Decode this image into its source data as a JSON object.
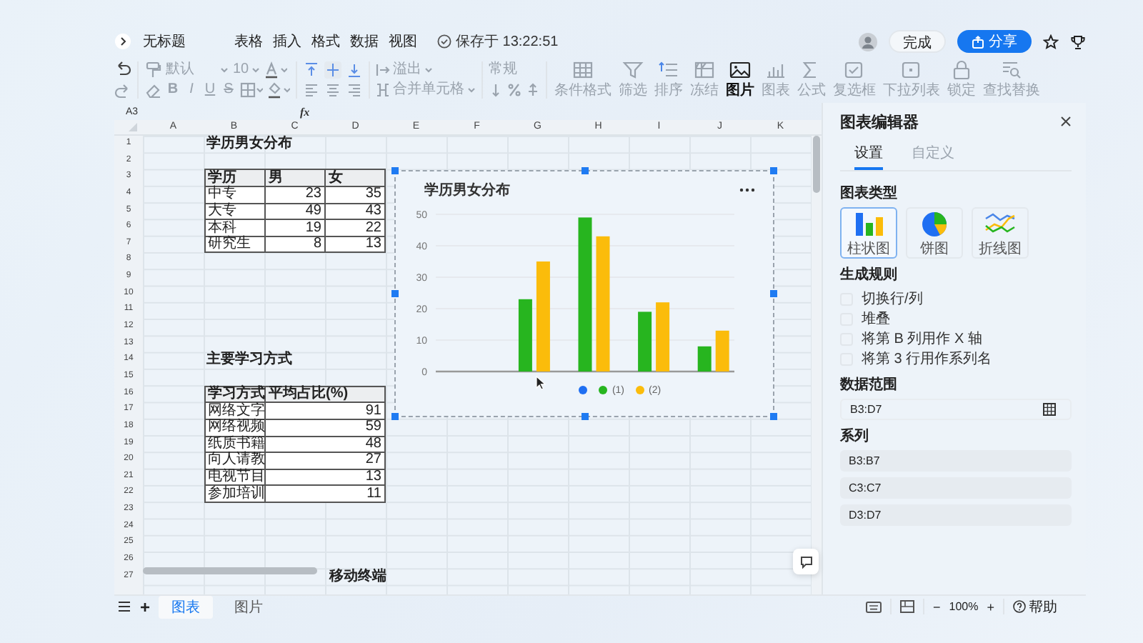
{
  "topbar": {
    "title": "无标题",
    "menus": [
      "表格",
      "插入",
      "格式",
      "数据",
      "视图"
    ],
    "save_status": "保存于 13:22:51",
    "done_button": "完成",
    "share_button": "分享"
  },
  "toolbar": {
    "font": "默认",
    "font_size": "10",
    "format_buttons": [
      "B",
      "I",
      "U",
      "S"
    ],
    "wrap": "溢出",
    "merge": "合并单元格",
    "number_format": "常规",
    "tools": [
      {
        "kind": "conditional",
        "label": "条件格式",
        "active": false
      },
      {
        "kind": "filter",
        "label": "筛选",
        "active": false
      },
      {
        "kind": "sort",
        "label": "排序",
        "active": false
      },
      {
        "kind": "freeze",
        "label": "冻结",
        "active": false
      },
      {
        "kind": "image",
        "label": "图片",
        "active": true
      },
      {
        "kind": "chart",
        "label": "图表",
        "active": false
      },
      {
        "kind": "formula",
        "label": "公式",
        "active": false
      },
      {
        "kind": "checkbox",
        "label": "复选框",
        "active": false
      },
      {
        "kind": "dropdown",
        "label": "下拉列表",
        "active": false
      },
      {
        "kind": "lock",
        "label": "锁定",
        "active": false
      },
      {
        "kind": "find",
        "label": "查找替换",
        "active": false
      }
    ]
  },
  "formula_bar": {
    "cell": "A3",
    "fx": "fx"
  },
  "sheet": {
    "columns": [
      "A",
      "B",
      "C",
      "D",
      "E",
      "F",
      "G",
      "H",
      "I",
      "J",
      "K"
    ],
    "rows": [
      "1",
      "2",
      "3",
      "4",
      "5",
      "6",
      "7",
      "8",
      "9",
      "10",
      "11",
      "12",
      "13",
      "14",
      "15",
      "16",
      "17",
      "18",
      "19",
      "20",
      "21",
      "22",
      "23",
      "24",
      "25",
      "26",
      "27"
    ],
    "tables": [
      {
        "title": "学历男女分布",
        "columns": [
          "学历",
          "男",
          "女"
        ],
        "rows": [
          [
            "中专",
            "23",
            "35"
          ],
          [
            "大专",
            "49",
            "43"
          ],
          [
            "本科",
            "19",
            "22"
          ],
          [
            "研究生",
            "8",
            "13"
          ]
        ]
      },
      {
        "title": "主要学习方式",
        "columns": [
          "学习方式",
          "平均占比(%)"
        ],
        "rows": [
          [
            "网络文字",
            "91"
          ],
          [
            "网络视频",
            "59"
          ],
          [
            "纸质书籍",
            "48"
          ],
          [
            "向人请教",
            "27"
          ],
          [
            "电视节目",
            "13"
          ],
          [
            "参加培训",
            "11"
          ]
        ]
      }
    ],
    "partial_cell": "移动终端",
    "chart": {
      "chart_data": {
        "type": "bar",
        "title": "学历男女分布",
        "grid": true,
        "legend": true,
        "ylim": [
          0,
          50
        ],
        "yticks": [
          0,
          10,
          20,
          30,
          40,
          50
        ],
        "series": [
          {
            "color": "#1f6ff2",
            "values": [
              null,
              null,
              null,
              null,
              null
            ]
          },
          {
            "name": "(1)",
            "color": "#27b51f",
            "values": [
              null,
              23,
              49,
              19,
              8
            ]
          },
          {
            "name": "(2)",
            "color": "#fbbc0b",
            "values": [
              null,
              35,
              43,
              22,
              13
            ]
          }
        ]
      }
    }
  },
  "panel": {
    "title": "图表编辑器",
    "tabs": [
      {
        "label": "设置",
        "selected": true
      },
      {
        "label": "自定义",
        "selected": false
      }
    ],
    "chart_type_heading": "图表类型",
    "chart_types": [
      {
        "kind": "bar",
        "label": "柱状图",
        "selected": true
      },
      {
        "kind": "pie",
        "label": "饼图",
        "selected": false
      },
      {
        "kind": "line",
        "label": "折线图",
        "selected": false
      }
    ],
    "rules_heading": "生成规则",
    "rules": [
      {
        "label": "切换行/列",
        "checked": false
      },
      {
        "label": "堆叠",
        "checked": false
      },
      {
        "label": "将第 B 列用作 X 轴",
        "checked": false
      },
      {
        "label": "将第 3 行用作系列名",
        "checked": false
      }
    ],
    "range_heading": "数据范围",
    "range": "B3:D7",
    "series_heading": "系列",
    "series": [
      "B3:B7",
      "C3:C7",
      "D3:D7"
    ]
  },
  "bottombar": {
    "add_sheet": "+",
    "sheets": [
      {
        "label": "图表",
        "selected": true
      },
      {
        "label": "图片",
        "selected": false
      }
    ],
    "zoom_out": "−",
    "zoom": "100%",
    "zoom_in": "+",
    "help": "帮助"
  }
}
